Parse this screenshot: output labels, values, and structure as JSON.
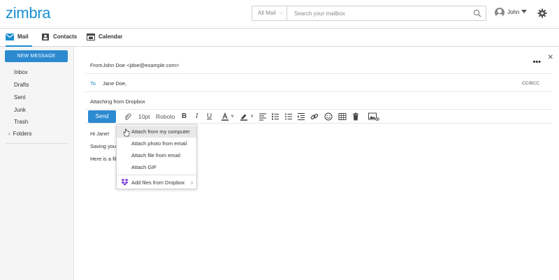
{
  "app": {
    "logo": "zimbra",
    "brand_color": "#1a8fd1",
    "accent_color": "#2c8ad1"
  },
  "header": {
    "search_scope": "All Mail",
    "search_placeholder": "Search your mailbox",
    "user_name": "John"
  },
  "tabs": [
    {
      "label": "Mail",
      "icon": "envelope-icon"
    },
    {
      "label": "Contacts",
      "icon": "contacts-icon"
    },
    {
      "label": "Calendar",
      "icon": "calendar-icon"
    }
  ],
  "sidebar": {
    "new_message": "NEW MESSAGE",
    "folders": [
      "Inbox",
      "Drafts",
      "Sent",
      "Junk",
      "Trash"
    ],
    "folders_group": "Folders"
  },
  "compose": {
    "from_label": "From",
    "from_value": "John Doe <jdoe@example.com>",
    "to_label": "To",
    "to_value": "Jane Doe,",
    "ccbcc": "CC/BCC",
    "subject": "Attaching from Dropbox",
    "send": "Send",
    "font_size": "10pt",
    "font_family": "Roboto",
    "body_lines": [
      "Hi Jane!",
      "Saving your",
      "Here is a file"
    ]
  },
  "attach_menu": {
    "items": [
      "Attach from my computer",
      "Attach photo from email",
      "Attach file from email",
      "Attach GIF"
    ],
    "dropbox": "Add files from Dropbox"
  }
}
